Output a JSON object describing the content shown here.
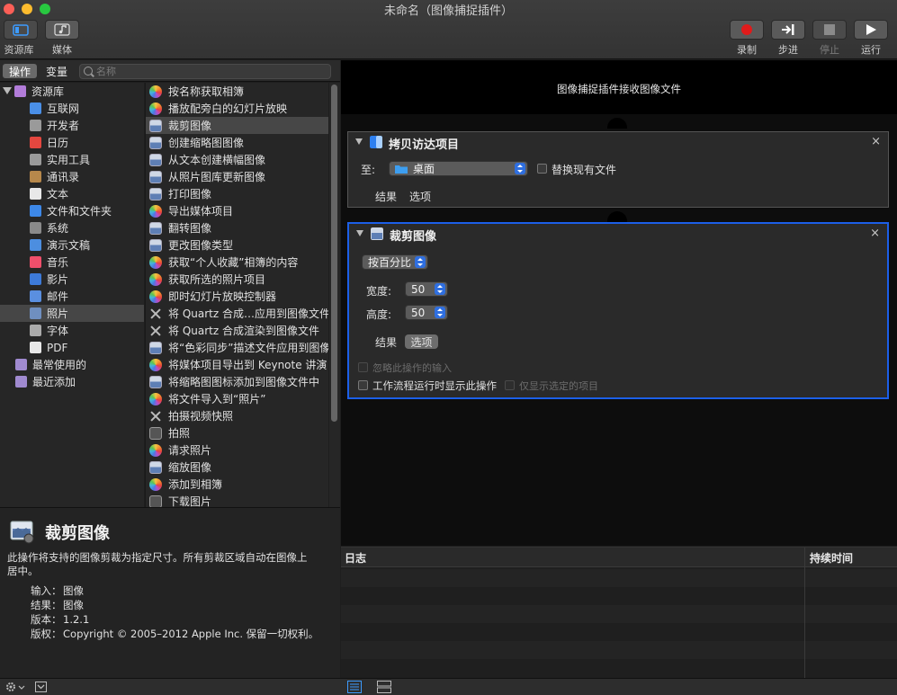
{
  "window": {
    "title": "未命名（图像捕捉插件）"
  },
  "toolbar": {
    "library_label": "资源库",
    "media_label": "媒体",
    "record_label": "录制",
    "step_label": "步进",
    "stop_label": "停止",
    "run_label": "运行"
  },
  "library_tabs": {
    "actions": "操作",
    "variables": "变量",
    "search_placeholder": "名称"
  },
  "categories": [
    {
      "label": "资源库",
      "color": "#b27cd9"
    },
    {
      "label": "互联网",
      "color": "#4a8fe7"
    },
    {
      "label": "开发者",
      "color": "#9a9a9a"
    },
    {
      "label": "日历",
      "color": "#e4473f"
    },
    {
      "label": "实用工具",
      "color": "#9a9a9a"
    },
    {
      "label": "通讯录",
      "color": "#b7884b"
    },
    {
      "label": "文本",
      "color": "#e8e8e8"
    },
    {
      "label": "文件和文件夹",
      "color": "#3d88e8"
    },
    {
      "label": "系统",
      "color": "#8a8a8a"
    },
    {
      "label": "演示文稿",
      "color": "#4c8ee0"
    },
    {
      "label": "音乐",
      "color": "#ef4f6b"
    },
    {
      "label": "影片",
      "color": "#3d7ad8"
    },
    {
      "label": "邮件",
      "color": "#5a8fe0"
    },
    {
      "label": "照片",
      "color": "#6f8fc0"
    },
    {
      "label": "字体",
      "color": "#aaaaaa"
    },
    {
      "label": "PDF",
      "color": "#e8e8e8"
    },
    {
      "label": "最常使用的",
      "color": "#a08ad0"
    },
    {
      "label": "最近添加",
      "color": "#a08ad0"
    }
  ],
  "actions": [
    {
      "label": "按名称获取相簿",
      "icon": "photos"
    },
    {
      "label": "播放配旁白的幻灯片放映",
      "icon": "photos"
    },
    {
      "label": "裁剪图像",
      "icon": "image"
    },
    {
      "label": "创建缩略图图像",
      "icon": "image"
    },
    {
      "label": "从文本创建横幅图像",
      "icon": "image"
    },
    {
      "label": "从照片图库更新图像",
      "icon": "image"
    },
    {
      "label": "打印图像",
      "icon": "image"
    },
    {
      "label": "导出媒体项目",
      "icon": "photos"
    },
    {
      "label": "翻转图像",
      "icon": "image"
    },
    {
      "label": "更改图像类型",
      "icon": "image"
    },
    {
      "label": "获取“个人收藏”相簿的内容",
      "icon": "photos"
    },
    {
      "label": "获取所选的照片项目",
      "icon": "photos"
    },
    {
      "label": "即时幻灯片放映控制器",
      "icon": "photos"
    },
    {
      "label": "将 Quartz 合成…应用到图像文件",
      "icon": "quartz"
    },
    {
      "label": "将 Quartz 合成渲染到图像文件",
      "icon": "quartz"
    },
    {
      "label": "将“色彩同步”描述文件应用到图像",
      "icon": "image"
    },
    {
      "label": "将媒体项目导出到 Keynote 讲演",
      "icon": "photos"
    },
    {
      "label": "将缩略图图标添加到图像文件中",
      "icon": "image"
    },
    {
      "label": "将文件导入到“照片”",
      "icon": "photos"
    },
    {
      "label": "拍摄视频快照",
      "icon": "quartz"
    },
    {
      "label": "拍照",
      "icon": "camera"
    },
    {
      "label": "请求照片",
      "icon": "photos"
    },
    {
      "label": "缩放图像",
      "icon": "image"
    },
    {
      "label": "添加到相簿",
      "icon": "photos"
    },
    {
      "label": "下载图片",
      "icon": "camera"
    }
  ],
  "description": {
    "title": "裁剪图像",
    "text": "此操作将支持的图像剪裁为指定尺寸。所有剪裁区域自动在图像上居中。",
    "input_key": "输入：",
    "input_val": "图像",
    "result_key": "结果：",
    "result_val": "图像",
    "version_key": "版本：",
    "version_val": "1.2.1",
    "copyright_key": "版权：",
    "copyright_val": "Copyright © 2005–2012 Apple Inc. 保留一切权利。"
  },
  "workflow": {
    "header": "图像捕捉插件接收图像文件",
    "copy_panel": {
      "title": "拷贝访达项目",
      "to_label": "至:",
      "destination": "桌面",
      "replace_label": "替换现有文件",
      "results_tab": "结果",
      "options_tab": "选项"
    },
    "crop_panel": {
      "title": "裁剪图像",
      "mode": "按百分比",
      "width_label": "宽度:",
      "width_value": "50",
      "height_label": "高度:",
      "height_value": "50",
      "results_tab": "结果",
      "options_tab": "选项",
      "ignore_input_label": "忽略此操作的输入",
      "show_action_label": "工作流程运行时显示此操作",
      "show_selected_label": "仅显示选定的项目"
    }
  },
  "log": {
    "col_log": "日志",
    "col_duration": "持续时间"
  }
}
